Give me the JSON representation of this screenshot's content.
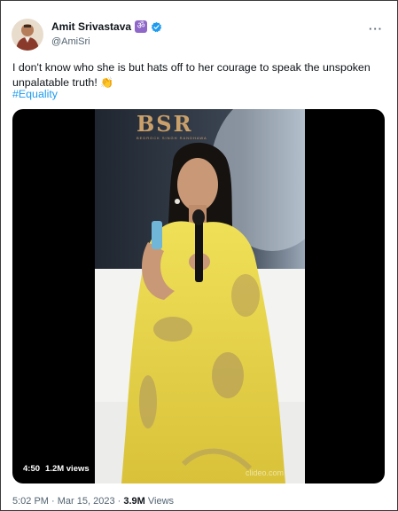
{
  "tweet": {
    "author": {
      "display_name": "Amit Srivastava",
      "handle": "@AmiSri",
      "badge": "ॐ",
      "avatar_icon": "person-avatar",
      "verified_color": "#1d9bf0"
    },
    "more_label": "···",
    "text": "I don't know who she is but hats off to her courage to speak the unspoken unpalatable truth!",
    "emoji": "👏",
    "hashtag": "#Equality",
    "media": {
      "brand": "BSR",
      "brand_subtitle": "BEDROCK SINGH RANDHAWA",
      "watermark": "clideo.com",
      "duration": "4:50",
      "views": "1.2M views"
    },
    "meta": {
      "time_date": "5:02 PM · Mar 15, 2023 ·",
      "views_count": "3.9M",
      "views_label": "Views"
    }
  },
  "colors": {
    "link": "#1d9bf0",
    "secondary_text": "#536471",
    "saree": "#e6d24a"
  }
}
